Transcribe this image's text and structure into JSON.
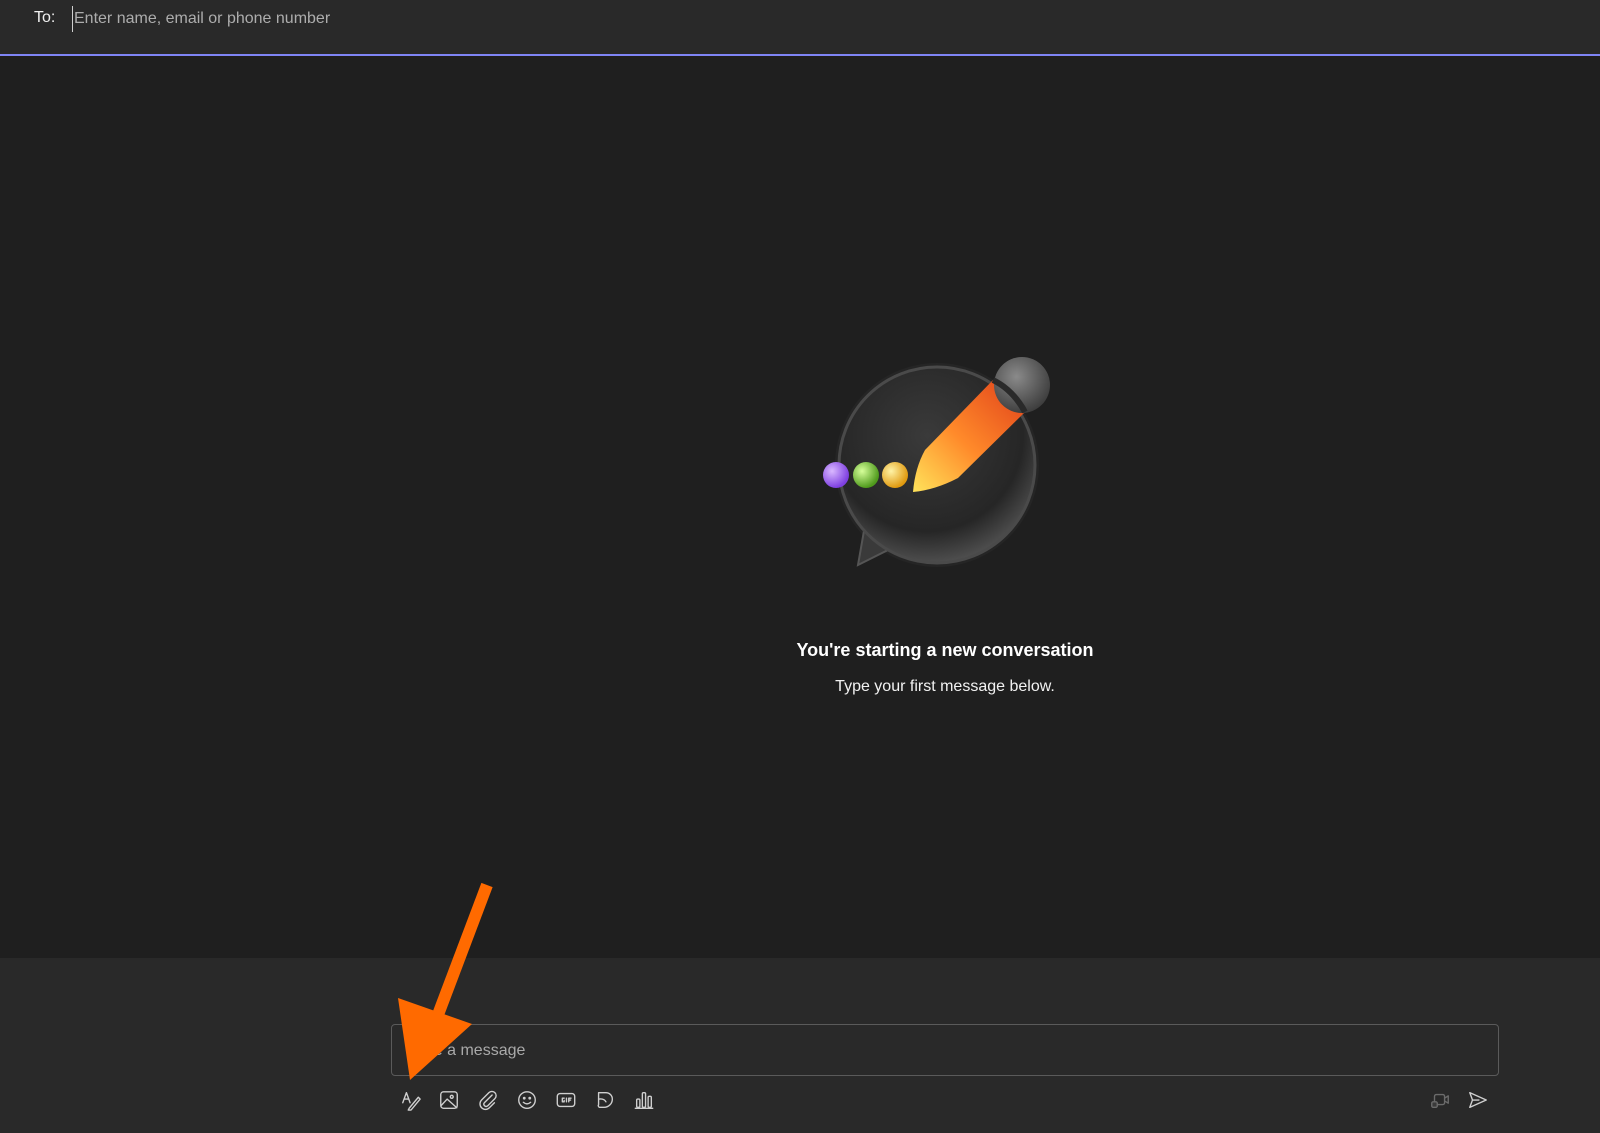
{
  "to_bar": {
    "label": "To:",
    "placeholder": "Enter name, email or phone number"
  },
  "empty_state": {
    "title": "You're starting a new conversation",
    "subtitle": "Type your first message below."
  },
  "compose": {
    "placeholder": "Type a message",
    "tools": [
      "format-icon",
      "image-icon",
      "attach-icon",
      "emoji-icon",
      "gif-icon",
      "sticker-icon",
      "poll-icon"
    ],
    "right_tools": [
      "video-clip-icon",
      "send-icon"
    ]
  },
  "colors": {
    "accent": "#7f85f5",
    "annotation_arrow": "#ff6a00",
    "dot_purple": "#a46bff",
    "dot_green": "#7bc93a",
    "dot_yellow": "#f4c531"
  }
}
